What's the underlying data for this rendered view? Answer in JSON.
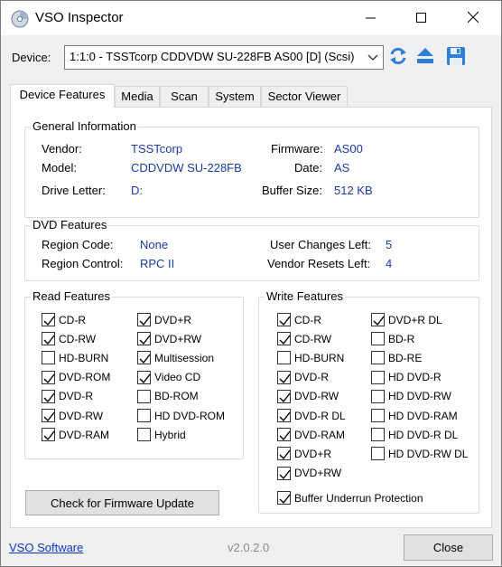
{
  "window": {
    "title": "VSO Inspector",
    "app_icon": "disc-icon",
    "controls": [
      "minimize-icon",
      "maximize-icon",
      "close-icon"
    ]
  },
  "device": {
    "label": "Device:",
    "selected": "1:1:0 - TSSTcorp CDDVDW SU-228FB AS00 [D] (Scsi)",
    "toolbar_icons": [
      "refresh-icon",
      "eject-icon",
      "save-icon"
    ]
  },
  "tabs": [
    {
      "label": "Device Features",
      "active": true
    },
    {
      "label": "Media",
      "active": false
    },
    {
      "label": "Scan",
      "active": false
    },
    {
      "label": "System",
      "active": false
    },
    {
      "label": "Sector Viewer",
      "active": false
    }
  ],
  "general": {
    "title": "General Information",
    "vendor_label": "Vendor:",
    "vendor": "TSSTcorp",
    "model_label": "Model:",
    "model": "CDDVDW SU-228FB",
    "drive_letter_label": "Drive Letter:",
    "drive_letter": "D:",
    "firmware_label": "Firmware:",
    "firmware": "AS00",
    "date_label": "Date:",
    "date": "AS",
    "buffer_label": "Buffer Size:",
    "buffer": "512 KB"
  },
  "dvd": {
    "title": "DVD Features",
    "region_code_label": "Region Code:",
    "region_code": "None",
    "region_control_label": "Region Control:",
    "region_control": "RPC II",
    "user_changes_label": "User Changes Left:",
    "user_changes": "5",
    "vendor_resets_label": "Vendor Resets Left:",
    "vendor_resets": "4"
  },
  "read": {
    "title": "Read Features",
    "col1": [
      {
        "label": "CD-R",
        "checked": true
      },
      {
        "label": "CD-RW",
        "checked": true
      },
      {
        "label": "HD-BURN",
        "checked": false
      },
      {
        "label": "DVD-ROM",
        "checked": true
      },
      {
        "label": "DVD-R",
        "checked": true
      },
      {
        "label": "DVD-RW",
        "checked": true
      },
      {
        "label": "DVD-RAM",
        "checked": true
      }
    ],
    "col2": [
      {
        "label": "DVD+R",
        "checked": true
      },
      {
        "label": "DVD+RW",
        "checked": true
      },
      {
        "label": "Multisession",
        "checked": true
      },
      {
        "label": "Video CD",
        "checked": true
      },
      {
        "label": "BD-ROM",
        "checked": false
      },
      {
        "label": "HD DVD-ROM",
        "checked": false
      },
      {
        "label": "Hybrid",
        "checked": false
      }
    ]
  },
  "write": {
    "title": "Write Features",
    "col1": [
      {
        "label": "CD-R",
        "checked": true
      },
      {
        "label": "CD-RW",
        "checked": true
      },
      {
        "label": "HD-BURN",
        "checked": false
      },
      {
        "label": "DVD-R",
        "checked": true
      },
      {
        "label": "DVD-RW",
        "checked": true
      },
      {
        "label": "DVD-R DL",
        "checked": true
      },
      {
        "label": "DVD-RAM",
        "checked": true
      },
      {
        "label": "DVD+R",
        "checked": true
      },
      {
        "label": "DVD+RW",
        "checked": true
      }
    ],
    "col2": [
      {
        "label": "DVD+R DL",
        "checked": true
      },
      {
        "label": "BD-R",
        "checked": false
      },
      {
        "label": "BD-RE",
        "checked": false
      },
      {
        "label": "HD DVD-R",
        "checked": false
      },
      {
        "label": "HD DVD-RW",
        "checked": false
      },
      {
        "label": "HD DVD-RAM",
        "checked": false
      },
      {
        "label": "HD DVD-R DL",
        "checked": false
      },
      {
        "label": "HD DVD-RW DL",
        "checked": false
      }
    ],
    "buffer_underrun": {
      "label": "Buffer Underrun Protection",
      "checked": true
    }
  },
  "buttons": {
    "firmware_update": "Check for Firmware Update",
    "close": "Close"
  },
  "footer": {
    "link": "VSO Software",
    "version": "v2.0.2.0"
  }
}
